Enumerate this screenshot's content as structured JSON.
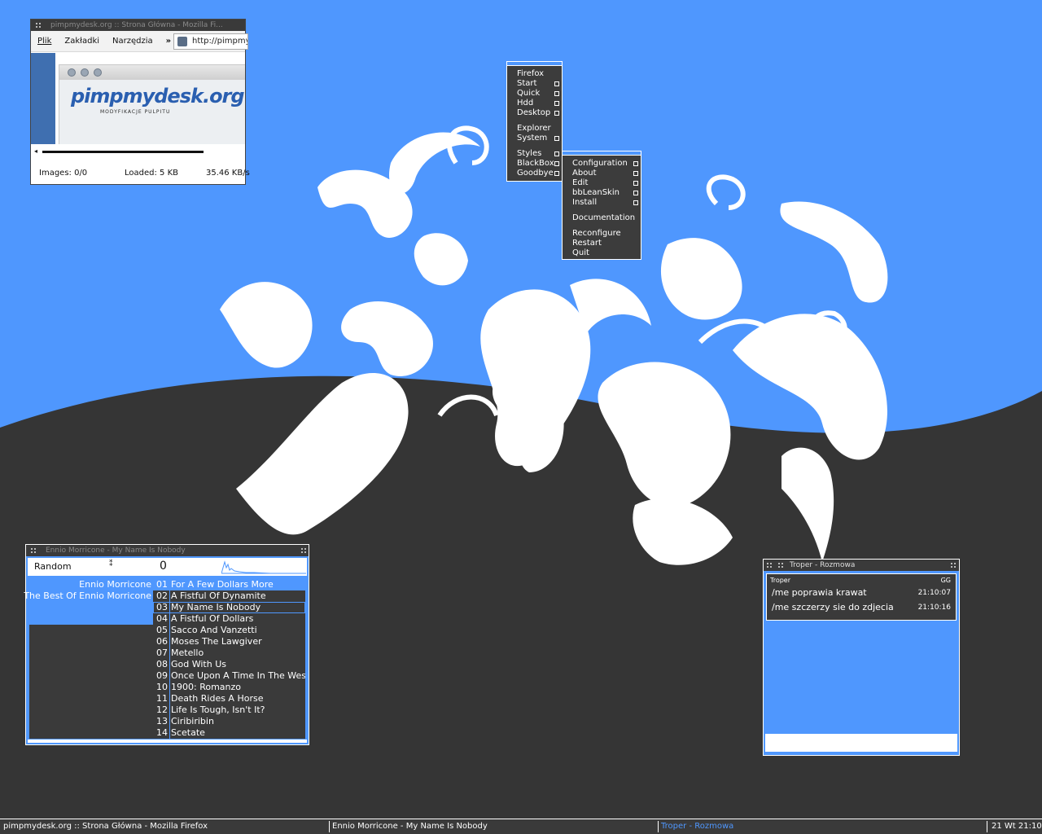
{
  "colors": {
    "accent": "#4f97fe",
    "dark": "#3a3a3a",
    "light": "#ffffff"
  },
  "firefox": {
    "title": "pimpmydesk.org :: Strona Główna - Mozilla Fi...",
    "menu": [
      "Plik",
      "Zakładki",
      "Narzędzia"
    ],
    "overflow_label": "»",
    "url": "http://pimpmy",
    "page_logo": "pimpmydesk.org",
    "page_tagline": "MODYFIKACJE PULPITU",
    "status": {
      "images": "Images: 0/0",
      "loaded": "Loaded: 5 KB",
      "speed": "35.46 KB/s"
    }
  },
  "root_menu": {
    "items": [
      {
        "label": "Firefox",
        "submenu": false
      },
      {
        "label": "Start",
        "submenu": true
      },
      {
        "label": "Quick",
        "submenu": true
      },
      {
        "label": "Hdd",
        "submenu": true
      },
      {
        "label": "Desktop",
        "submenu": true
      },
      {
        "label": "Explorer",
        "submenu": false
      },
      {
        "label": "System",
        "submenu": true
      },
      {
        "label": "Styles",
        "submenu": true
      },
      {
        "label": "BlackBox",
        "submenu": true
      },
      {
        "label": "Goodbye",
        "submenu": true
      }
    ]
  },
  "blackbox_menu": {
    "items": [
      {
        "label": "Configuration",
        "submenu": true
      },
      {
        "label": "About",
        "submenu": true
      },
      {
        "label": "Edit",
        "submenu": true
      },
      {
        "label": "bbLeanSkin",
        "submenu": true
      },
      {
        "label": "Install",
        "submenu": true
      },
      {
        "label": "Documentation",
        "submenu": false
      },
      {
        "label": "Reconfigure",
        "submenu": false
      },
      {
        "label": "Restart",
        "submenu": false
      },
      {
        "label": "Quit",
        "submenu": false
      }
    ]
  },
  "player": {
    "title": "Ennio Morricone - My Name Is Nobody",
    "mode": "Random",
    "counter": "0",
    "artist": "Ennio Morricone",
    "album": "The Best Of Ennio Morricone",
    "tracks": [
      {
        "num": "01",
        "title": "For A Few Dollars More"
      },
      {
        "num": "02",
        "title": "A Fistful Of Dynamite"
      },
      {
        "num": "03",
        "title": "My Name Is Nobody"
      },
      {
        "num": "04",
        "title": "A Fistful Of Dollars"
      },
      {
        "num": "05",
        "title": "Sacco And Vanzetti"
      },
      {
        "num": "06",
        "title": "Moses The Lawgiver"
      },
      {
        "num": "07",
        "title": "Metello"
      },
      {
        "num": "08",
        "title": "God With Us"
      },
      {
        "num": "09",
        "title": "Once Upon A Time In The West"
      },
      {
        "num": "10",
        "title": "1900: Romanzo"
      },
      {
        "num": "11",
        "title": "Death Rides A Horse"
      },
      {
        "num": "12",
        "title": "Life Is Tough, Isn't It?"
      },
      {
        "num": "13",
        "title": "Ciribiribin"
      },
      {
        "num": "14",
        "title": "Scetate"
      }
    ]
  },
  "chat": {
    "title": "Troper - Rozmowa",
    "contact": "Troper",
    "network": "GG",
    "messages": [
      {
        "text": "/me poprawia krawat",
        "time": "21:10:07"
      },
      {
        "text": "/me szczerzy sie do zdjecia",
        "time": "21:10:16"
      }
    ]
  },
  "taskbar": {
    "tasks": [
      "pimpmydesk.org :: Strona Główna - Mozilla Firefox",
      "Ennio Morricone - My Name Is Nobody",
      "Troper - Rozmowa"
    ],
    "clock": "21 Wt 21:10"
  }
}
